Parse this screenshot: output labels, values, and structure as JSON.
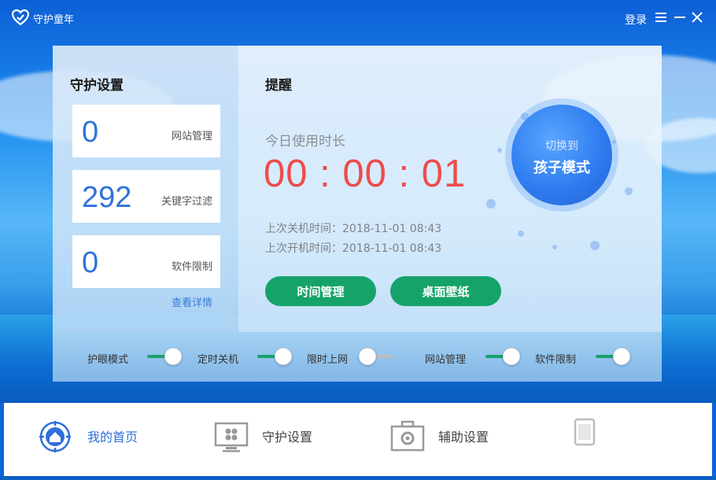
{
  "app": {
    "title": "守护童年",
    "login": "登录"
  },
  "settings": {
    "title": "守护设置",
    "cards": [
      {
        "value": "0",
        "label": "网站管理"
      },
      {
        "value": "292",
        "label": "关键字过滤"
      },
      {
        "value": "0",
        "label": "软件限制"
      }
    ],
    "details_link": "查看详情"
  },
  "reminder": {
    "title": "提醒",
    "usage_label": "今日使用时长",
    "timer": "00 : 00 : 01",
    "last_shutdown": "上次关机时间：2018-11-01   08:43",
    "last_boot": "上次开机时间：2018-11-01   08:43",
    "btn_time": "时间管理",
    "btn_wallpaper": "桌面壁纸",
    "switch_line1": "切换到",
    "switch_line2": "孩子模式"
  },
  "toggles": [
    {
      "label": "护眼模式",
      "on": true
    },
    {
      "label": "定时关机",
      "on": true
    },
    {
      "label": "限时上网",
      "on": false
    },
    {
      "label": "网站管理",
      "on": true
    },
    {
      "label": "软件限制",
      "on": true
    }
  ],
  "nav": [
    {
      "label": "我的首页",
      "icon": "home-target-icon",
      "active": true
    },
    {
      "label": "守护设置",
      "icon": "monitor-grid-icon",
      "active": false
    },
    {
      "label": "辅助设置",
      "icon": "toolbox-gear-icon",
      "active": false
    },
    {
      "label": "",
      "icon": "tablet-icon",
      "active": false
    }
  ],
  "colors": {
    "accent": "#2f73d8",
    "green": "#16a36a",
    "timer": "#ee4c4c"
  }
}
